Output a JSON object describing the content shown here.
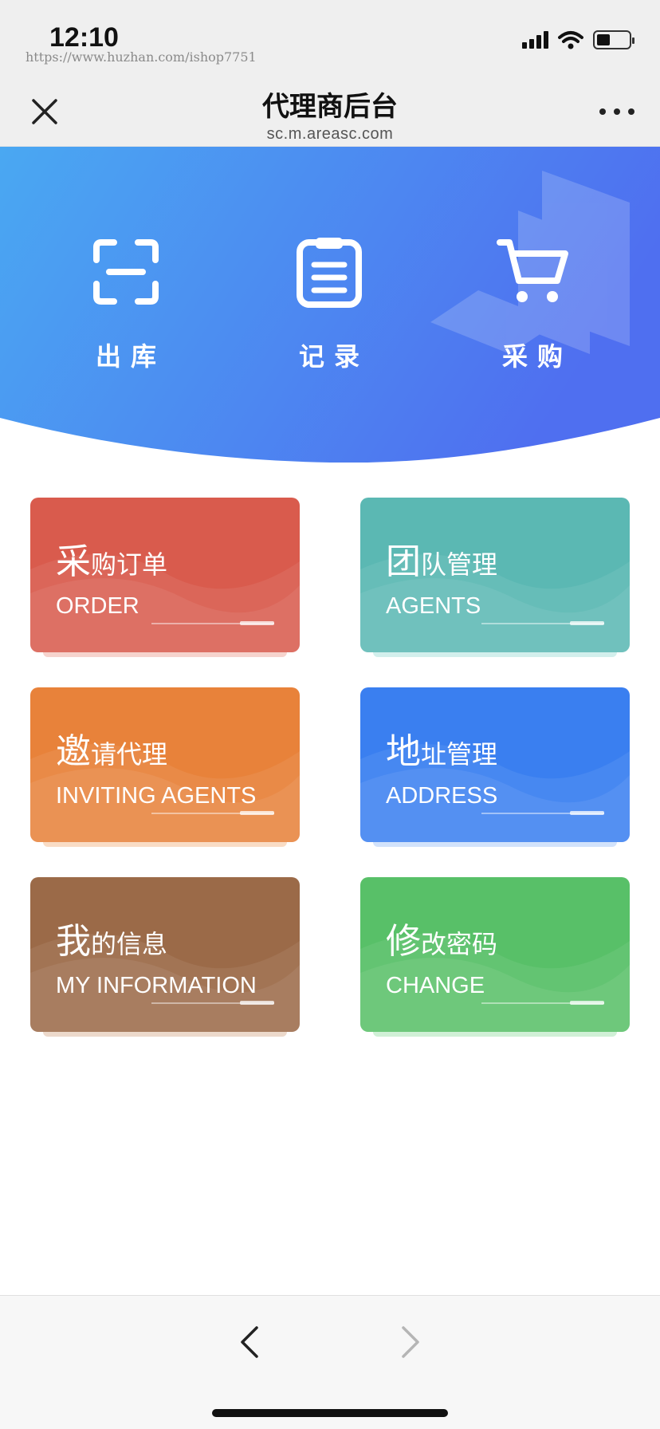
{
  "status_bar": {
    "time": "12:10",
    "watermark": "https://www.huzhan.com/ishop7751"
  },
  "nav": {
    "title": "代理商后台",
    "subtitle": "sc.m.areasc.com"
  },
  "quick_actions": [
    {
      "label": "出库",
      "icon": "scan-icon"
    },
    {
      "label": "记录",
      "icon": "clipboard-icon"
    },
    {
      "label": "采购",
      "icon": "cart-icon"
    }
  ],
  "cards": [
    {
      "title_first": "采",
      "title_rest": "购订单",
      "english": "ORDER",
      "color": "#d95b4d",
      "shadow": "#f6d3cd"
    },
    {
      "title_first": "团",
      "title_rest": "队管理",
      "english": "AGENTS",
      "color": "#5bb8b3",
      "shadow": "#d2efec"
    },
    {
      "title_first": "邀",
      "title_rest": "请代理",
      "english": "INVITING AGENTS",
      "color": "#e8823a",
      "shadow": "#f9dcc5"
    },
    {
      "title_first": "地",
      "title_rest": "址管理",
      "english": "ADDRESS",
      "color": "#3a7ff0",
      "shadow": "#d2e2fb"
    },
    {
      "title_first": "我",
      "title_rest": "的信息",
      "english": "MY INFORMATION",
      "color": "#9b6a48",
      "shadow": "#ecd9cb"
    },
    {
      "title_first": "修",
      "title_rest": "改密码",
      "english": "CHANGE",
      "color": "#58c068",
      "shadow": "#d0f0d6"
    }
  ],
  "colors": {
    "banner_start": "#4aa8f2",
    "banner_end": "#4f6ff0",
    "bar_background": "#efefef"
  }
}
